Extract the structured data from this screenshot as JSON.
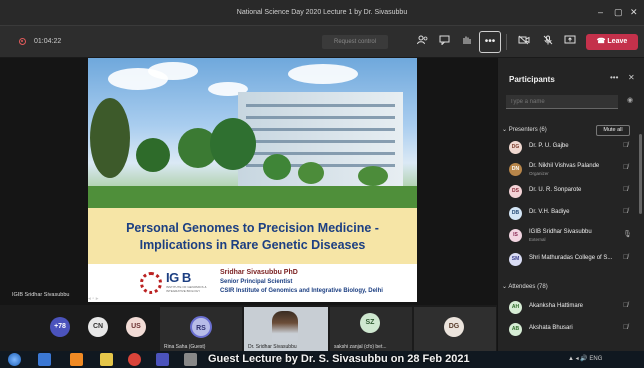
{
  "window": {
    "title": "National Science Day 2020 Lecture 1 by Dr. Sivasubbu",
    "controls": [
      "–",
      "▢",
      "✕"
    ]
  },
  "toolbar": {
    "timer": "01:04:22",
    "request_control": "Request control",
    "leave_label": "Leave",
    "more": "•••",
    "leave_color": "#c4314b"
  },
  "slide": {
    "title_line1": "Personal Genomes to Precision Medicine -",
    "title_line2": "Implications in Rare Genetic Diseases",
    "logo_text": "IG B",
    "logo_sub": "INSTITUTE OF GENOMICS & INTEGRATIVE BIOLOGY",
    "speaker_name": "Sridhar Sivasubbu PhD",
    "speaker_role": "Senior Principal Scientist",
    "speaker_inst": "CSIR Institute of Genomics and Integrative Biology, Delhi"
  },
  "stage": {
    "label": "IGIB Sridhar Sivasubbu",
    "share_controls": "◂ ▫ ▸"
  },
  "gallery": {
    "overflow": "+78",
    "avatars": [
      "CN",
      "US"
    ],
    "rs_initials": "RS",
    "rs_label": "Rina Saha (Guest)",
    "video_label": "Dr. Sridhar Sivasubbu",
    "sz_initials": "SZ",
    "sz_label": "sakshi zanjal (cfo) bet...",
    "dg_initials": "DG"
  },
  "panel": {
    "title": "Participants",
    "more": "•••",
    "close": "✕",
    "search_placeholder": "Type a name",
    "presenters_head": "Presenters (6)",
    "mute_all": "Mute all",
    "attendees_head": "Attendees (78)",
    "presenters": [
      {
        "initials": "DG",
        "name": "Dr. P. U. Gajbe",
        "sub": ""
      },
      {
        "initials": "DN",
        "name": "Dr. Nikhil Vishvas Palande",
        "sub": "Organizer"
      },
      {
        "initials": "DS",
        "name": "Dr. U. R. Sonparote",
        "sub": ""
      },
      {
        "initials": "DB",
        "name": "Dr. V.H. Badiye",
        "sub": ""
      },
      {
        "initials": "IS",
        "name": "IGIB Sridhar Sivasubbu",
        "sub": "External"
      },
      {
        "initials": "SM",
        "name": "Shri Mathuradas College of S...",
        "sub": ""
      }
    ],
    "attendees": [
      {
        "initials": "AH",
        "name": "Akanksha Hattimare"
      },
      {
        "initials": "AB",
        "name": "Akshata Bhusari"
      }
    ]
  },
  "banner": {
    "text": "Guest Lecture by Dr. S. Sivasubbu on 28 Feb 2021",
    "tray": "▲ ◂ 🔊 ENG"
  }
}
